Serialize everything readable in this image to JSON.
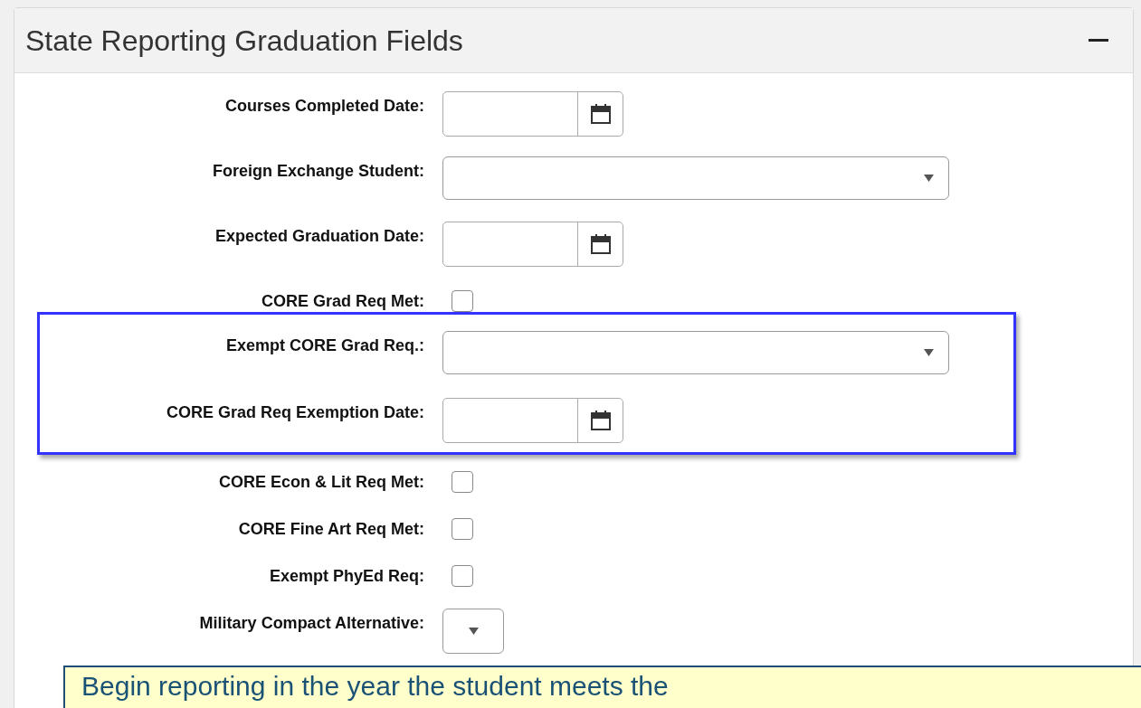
{
  "panel": {
    "title": "State Reporting Graduation Fields",
    "expanded": true
  },
  "fields": [
    {
      "label": "Courses Completed Date:",
      "kind": "date",
      "highlighted": false
    },
    {
      "label": "Foreign Exchange Student:",
      "kind": "select",
      "highlighted": false
    },
    {
      "label": "Expected Graduation Date:",
      "kind": "date",
      "highlighted": false
    },
    {
      "label": "CORE Grad Req Met:",
      "kind": "checkbox",
      "checked": false,
      "highlighted": false
    },
    {
      "label": "Exempt CORE Grad Req.:",
      "kind": "select",
      "highlighted": true
    },
    {
      "label": "CORE Grad Req Exemption Date:",
      "kind": "date",
      "highlighted": true
    },
    {
      "label": "CORE Econ & Lit Req Met:",
      "kind": "checkbox",
      "checked": false,
      "highlighted": false
    },
    {
      "label": "CORE Fine Art Req Met:",
      "kind": "checkbox",
      "checked": false,
      "highlighted": false
    },
    {
      "label": "Exempt PhyEd Req:",
      "kind": "checkbox",
      "checked": false,
      "highlighted": false
    },
    {
      "label": "Military Compact Alternative:",
      "kind": "select_small",
      "highlighted": false
    }
  ],
  "callout": {
    "text": "Begin reporting in the year the student meets the"
  }
}
